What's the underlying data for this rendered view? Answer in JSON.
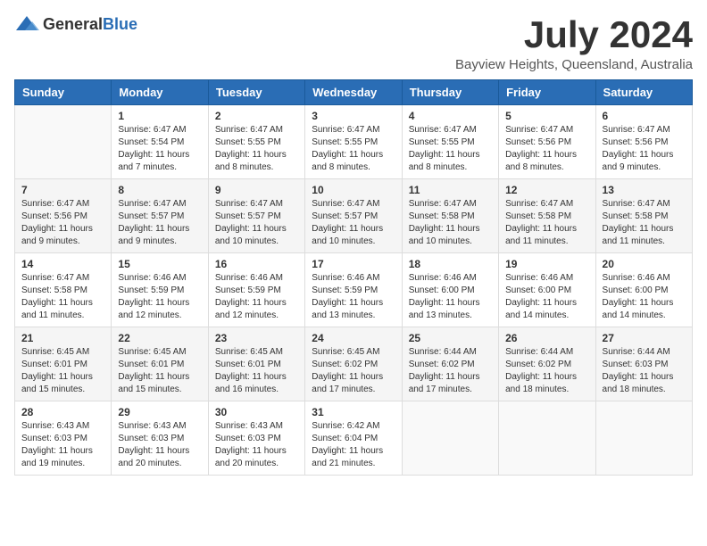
{
  "header": {
    "logo_general": "General",
    "logo_blue": "Blue",
    "title": "July 2024",
    "subtitle": "Bayview Heights, Queensland, Australia"
  },
  "weekdays": [
    "Sunday",
    "Monday",
    "Tuesday",
    "Wednesday",
    "Thursday",
    "Friday",
    "Saturday"
  ],
  "weeks": [
    [
      {
        "day": "",
        "content": ""
      },
      {
        "day": "1",
        "content": "Sunrise: 6:47 AM\nSunset: 5:54 PM\nDaylight: 11 hours and 7 minutes."
      },
      {
        "day": "2",
        "content": "Sunrise: 6:47 AM\nSunset: 5:55 PM\nDaylight: 11 hours and 8 minutes."
      },
      {
        "day": "3",
        "content": "Sunrise: 6:47 AM\nSunset: 5:55 PM\nDaylight: 11 hours and 8 minutes."
      },
      {
        "day": "4",
        "content": "Sunrise: 6:47 AM\nSunset: 5:55 PM\nDaylight: 11 hours and 8 minutes."
      },
      {
        "day": "5",
        "content": "Sunrise: 6:47 AM\nSunset: 5:56 PM\nDaylight: 11 hours and 8 minutes."
      },
      {
        "day": "6",
        "content": "Sunrise: 6:47 AM\nSunset: 5:56 PM\nDaylight: 11 hours and 9 minutes."
      }
    ],
    [
      {
        "day": "7",
        "content": "Sunrise: 6:47 AM\nSunset: 5:56 PM\nDaylight: 11 hours and 9 minutes."
      },
      {
        "day": "8",
        "content": "Sunrise: 6:47 AM\nSunset: 5:57 PM\nDaylight: 11 hours and 9 minutes."
      },
      {
        "day": "9",
        "content": "Sunrise: 6:47 AM\nSunset: 5:57 PM\nDaylight: 11 hours and 10 minutes."
      },
      {
        "day": "10",
        "content": "Sunrise: 6:47 AM\nSunset: 5:57 PM\nDaylight: 11 hours and 10 minutes."
      },
      {
        "day": "11",
        "content": "Sunrise: 6:47 AM\nSunset: 5:58 PM\nDaylight: 11 hours and 10 minutes."
      },
      {
        "day": "12",
        "content": "Sunrise: 6:47 AM\nSunset: 5:58 PM\nDaylight: 11 hours and 11 minutes."
      },
      {
        "day": "13",
        "content": "Sunrise: 6:47 AM\nSunset: 5:58 PM\nDaylight: 11 hours and 11 minutes."
      }
    ],
    [
      {
        "day": "14",
        "content": "Sunrise: 6:47 AM\nSunset: 5:58 PM\nDaylight: 11 hours and 11 minutes."
      },
      {
        "day": "15",
        "content": "Sunrise: 6:46 AM\nSunset: 5:59 PM\nDaylight: 11 hours and 12 minutes."
      },
      {
        "day": "16",
        "content": "Sunrise: 6:46 AM\nSunset: 5:59 PM\nDaylight: 11 hours and 12 minutes."
      },
      {
        "day": "17",
        "content": "Sunrise: 6:46 AM\nSunset: 5:59 PM\nDaylight: 11 hours and 13 minutes."
      },
      {
        "day": "18",
        "content": "Sunrise: 6:46 AM\nSunset: 6:00 PM\nDaylight: 11 hours and 13 minutes."
      },
      {
        "day": "19",
        "content": "Sunrise: 6:46 AM\nSunset: 6:00 PM\nDaylight: 11 hours and 14 minutes."
      },
      {
        "day": "20",
        "content": "Sunrise: 6:46 AM\nSunset: 6:00 PM\nDaylight: 11 hours and 14 minutes."
      }
    ],
    [
      {
        "day": "21",
        "content": "Sunrise: 6:45 AM\nSunset: 6:01 PM\nDaylight: 11 hours and 15 minutes."
      },
      {
        "day": "22",
        "content": "Sunrise: 6:45 AM\nSunset: 6:01 PM\nDaylight: 11 hours and 15 minutes."
      },
      {
        "day": "23",
        "content": "Sunrise: 6:45 AM\nSunset: 6:01 PM\nDaylight: 11 hours and 16 minutes."
      },
      {
        "day": "24",
        "content": "Sunrise: 6:45 AM\nSunset: 6:02 PM\nDaylight: 11 hours and 17 minutes."
      },
      {
        "day": "25",
        "content": "Sunrise: 6:44 AM\nSunset: 6:02 PM\nDaylight: 11 hours and 17 minutes."
      },
      {
        "day": "26",
        "content": "Sunrise: 6:44 AM\nSunset: 6:02 PM\nDaylight: 11 hours and 18 minutes."
      },
      {
        "day": "27",
        "content": "Sunrise: 6:44 AM\nSunset: 6:03 PM\nDaylight: 11 hours and 18 minutes."
      }
    ],
    [
      {
        "day": "28",
        "content": "Sunrise: 6:43 AM\nSunset: 6:03 PM\nDaylight: 11 hours and 19 minutes."
      },
      {
        "day": "29",
        "content": "Sunrise: 6:43 AM\nSunset: 6:03 PM\nDaylight: 11 hours and 20 minutes."
      },
      {
        "day": "30",
        "content": "Sunrise: 6:43 AM\nSunset: 6:03 PM\nDaylight: 11 hours and 20 minutes."
      },
      {
        "day": "31",
        "content": "Sunrise: 6:42 AM\nSunset: 6:04 PM\nDaylight: 11 hours and 21 minutes."
      },
      {
        "day": "",
        "content": ""
      },
      {
        "day": "",
        "content": ""
      },
      {
        "day": "",
        "content": ""
      }
    ]
  ]
}
